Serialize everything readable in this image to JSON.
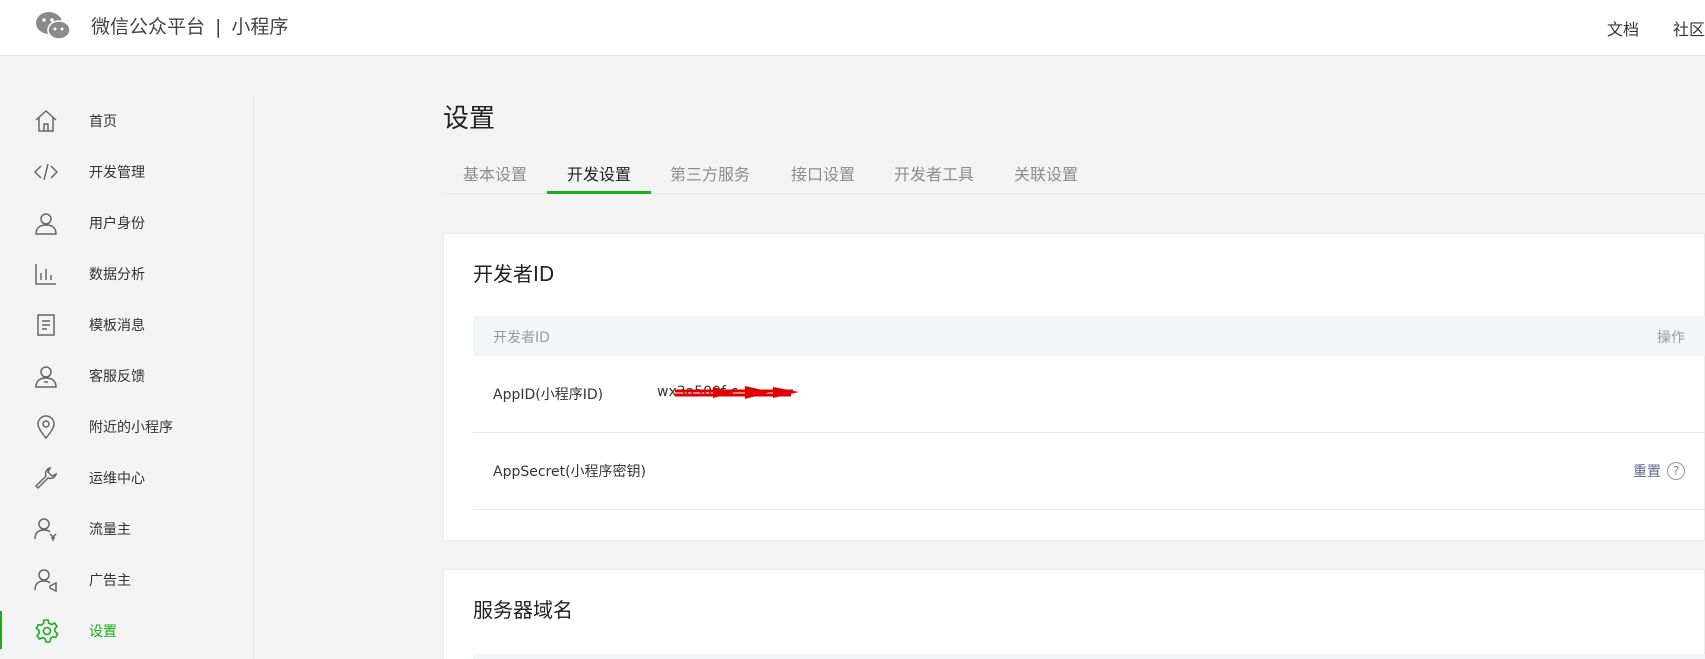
{
  "header": {
    "logo_icon": "wechat-logo-icon",
    "platform_name": "微信公众平台",
    "separator": "|",
    "product_name": "小程序",
    "links": [
      "文档",
      "社区"
    ]
  },
  "sidebar": {
    "items": [
      {
        "label": "首页",
        "icon": "home-icon"
      },
      {
        "label": "开发管理",
        "icon": "code-icon"
      },
      {
        "label": "用户身份",
        "icon": "user-icon"
      },
      {
        "label": "数据分析",
        "icon": "bar-chart-icon"
      },
      {
        "label": "模板消息",
        "icon": "document-icon"
      },
      {
        "label": "客服反馈",
        "icon": "customer-service-icon"
      },
      {
        "label": "附近的小程序",
        "icon": "location-pin-icon"
      },
      {
        "label": "运维中心",
        "icon": "wrench-icon"
      },
      {
        "label": "流量主",
        "icon": "user-yen-icon"
      },
      {
        "label": "广告主",
        "icon": "user-megaphone-icon"
      },
      {
        "label": "设置",
        "icon": "gear-icon",
        "active": true
      }
    ]
  },
  "main": {
    "title": "设置",
    "tabs": [
      {
        "label": "基本设置"
      },
      {
        "label": "开发设置",
        "active": true
      },
      {
        "label": "第三方服务"
      },
      {
        "label": "接口设置"
      },
      {
        "label": "开发者工具"
      },
      {
        "label": "关联设置"
      }
    ],
    "developer_card": {
      "title": "开发者ID",
      "table_header": {
        "left": "开发者ID",
        "right": "操作"
      },
      "rows": [
        {
          "label": "AppID(小程序ID)",
          "value": "wx3a500f       c"
        },
        {
          "label": "AppSecret(小程序密钥)",
          "action": "重置",
          "help": "?"
        }
      ]
    },
    "server_card": {
      "title": "服务器域名"
    }
  },
  "colors": {
    "accent": "#1aad19",
    "link": "#576b95",
    "background": "#f3f3f4",
    "redaction": "#e00000"
  }
}
